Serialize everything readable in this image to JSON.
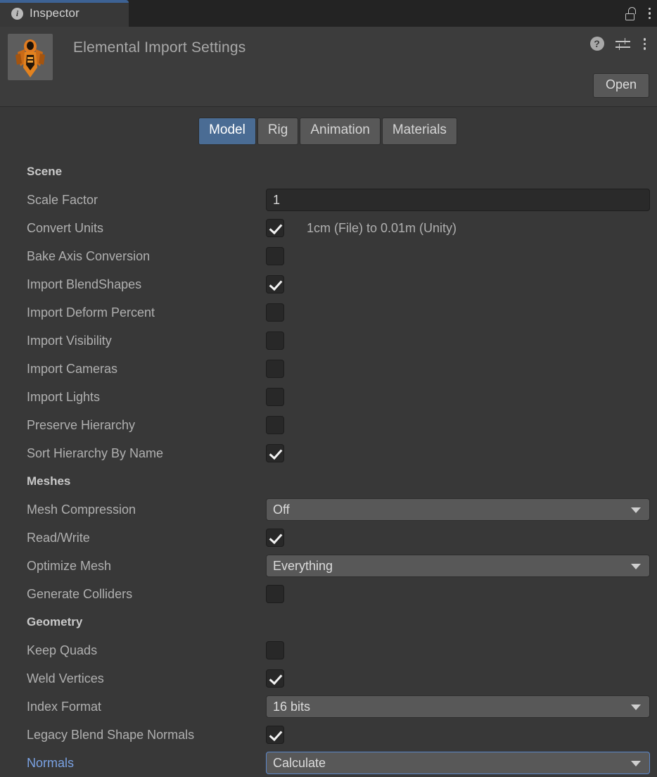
{
  "window": {
    "tab_label": "Inspector",
    "tab_icon": "info-icon",
    "lock_icon": "lock-open-icon",
    "menu_icon": "kebab-menu-icon"
  },
  "asset_header": {
    "title": "Elemental Import Settings",
    "thumbnail_icon": "elemental-model-thumbnail",
    "help_icon": "help-icon",
    "preset_icon": "preset-settings-icon",
    "overflow_icon": "kebab-menu-icon",
    "open_label": "Open"
  },
  "tabs": [
    {
      "label": "Model",
      "active": true
    },
    {
      "label": "Rig",
      "active": false
    },
    {
      "label": "Animation",
      "active": false
    },
    {
      "label": "Materials",
      "active": false
    }
  ],
  "sections": [
    {
      "title": "Scene",
      "rows": [
        {
          "label": "Scale Factor",
          "type": "text",
          "value": "1"
        },
        {
          "label": "Convert Units",
          "type": "checkbox",
          "checked": true,
          "note": "1cm (File) to 0.01m (Unity)"
        },
        {
          "label": "Bake Axis Conversion",
          "type": "checkbox",
          "checked": false
        },
        {
          "label": "Import BlendShapes",
          "type": "checkbox",
          "checked": true
        },
        {
          "label": "Import Deform Percent",
          "type": "checkbox",
          "checked": false
        },
        {
          "label": "Import Visibility",
          "type": "checkbox",
          "checked": false
        },
        {
          "label": "Import Cameras",
          "type": "checkbox",
          "checked": false
        },
        {
          "label": "Import Lights",
          "type": "checkbox",
          "checked": false
        },
        {
          "label": "Preserve Hierarchy",
          "type": "checkbox",
          "checked": false
        },
        {
          "label": "Sort Hierarchy By Name",
          "type": "checkbox",
          "checked": true
        }
      ]
    },
    {
      "title": "Meshes",
      "rows": [
        {
          "label": "Mesh Compression",
          "type": "dropdown",
          "value": "Off"
        },
        {
          "label": "Read/Write",
          "type": "checkbox",
          "checked": true
        },
        {
          "label": "Optimize Mesh",
          "type": "dropdown",
          "value": "Everything"
        },
        {
          "label": "Generate Colliders",
          "type": "checkbox",
          "checked": false
        }
      ]
    },
    {
      "title": "Geometry",
      "rows": [
        {
          "label": "Keep Quads",
          "type": "checkbox",
          "checked": false
        },
        {
          "label": "Weld Vertices",
          "type": "checkbox",
          "checked": true
        },
        {
          "label": "Index Format",
          "type": "dropdown",
          "value": "16 bits"
        },
        {
          "label": "Legacy Blend Shape Normals",
          "type": "checkbox",
          "checked": true
        },
        {
          "label": "Normals",
          "type": "dropdown",
          "value": "Calculate",
          "highlight": true,
          "focused": true
        }
      ]
    }
  ],
  "colors": {
    "window_bg": "#383838",
    "tabstrip_bg": "#232323",
    "accent_blue": "#3d6294",
    "tab_active_blue": "#4a6c94",
    "highlight_label": "#7aa2e3",
    "focus_border": "#5c87c9",
    "control_gray": "#585858",
    "field_dark": "#2a2a2a"
  }
}
